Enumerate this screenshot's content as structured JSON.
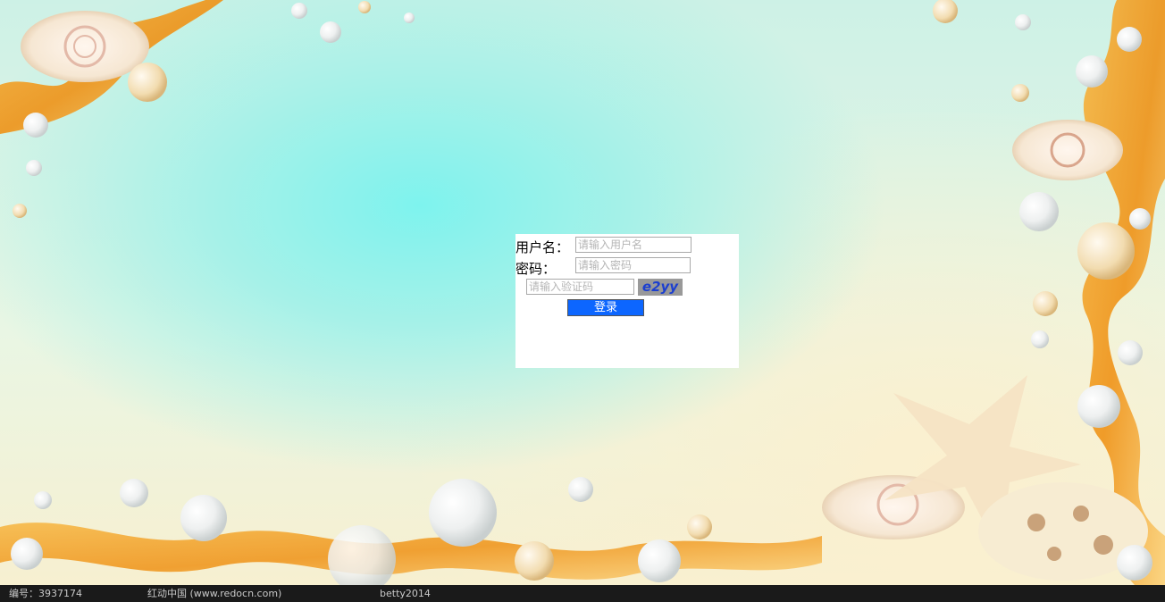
{
  "login": {
    "username_label": "用户名：",
    "username_placeholder": "请输入用户名",
    "password_label": "密码：",
    "password_placeholder": "请输入密码",
    "captcha_placeholder": "请输入验证码",
    "captcha_text": "e2yy",
    "submit_label": "登录"
  },
  "footer": {
    "id_text": "编号：3937174",
    "source_text": "红动中国 (www.redocn.com)",
    "author_text": "betty2014"
  },
  "colors": {
    "button": "#0c66ff",
    "captcha_bg": "#999999",
    "captcha_text": "#1c3fcf",
    "ribbon": "#f2a12a"
  }
}
